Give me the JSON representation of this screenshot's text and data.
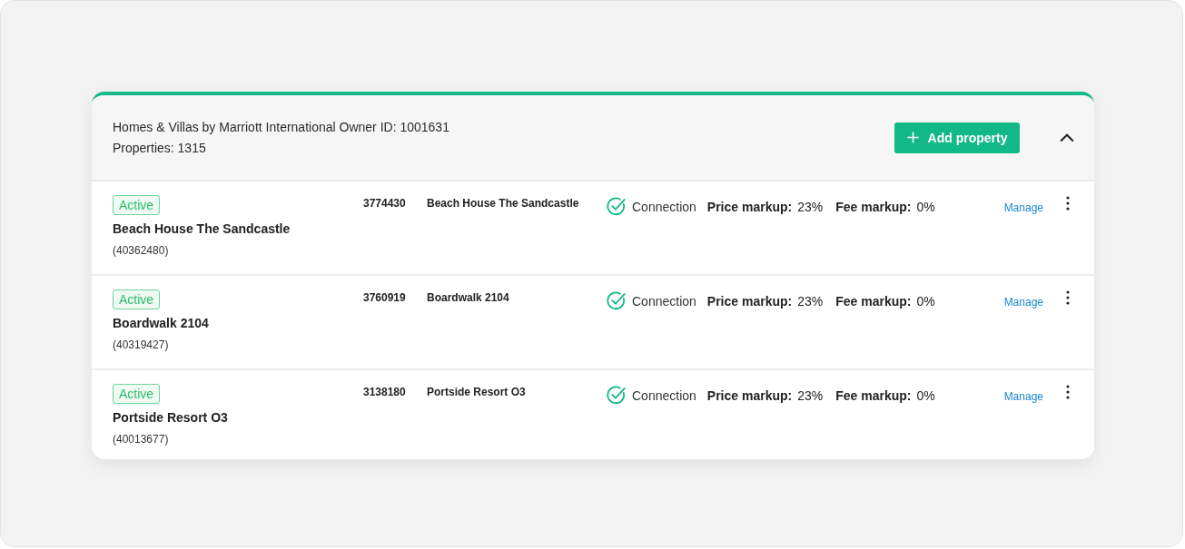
{
  "header": {
    "title": "Homes & Villas by Marriott International Owner ID: 1001631",
    "properties": "Properties: 1315",
    "add_button": "Add property",
    "expanded": true
  },
  "rows": [
    {
      "status": "Active",
      "name": "Beach House The Sandcastle",
      "id": "(40362480)",
      "code": "3774430",
      "listing": "Beach House The Sandcastle",
      "connection": "Connection",
      "connected": true,
      "price_label": "Price markup:",
      "price_value": "23%",
      "fee_label": "Fee markup:",
      "fee_value": "0%",
      "action": "Manage"
    },
    {
      "status": "Active",
      "name": "Boardwalk 2104",
      "id": "(40319427)",
      "code": "3760919",
      "listing": "Boardwalk 2104",
      "connection": "Connection",
      "connected": true,
      "price_label": "Price markup:",
      "price_value": "23%",
      "fee_label": "Fee markup:",
      "fee_value": "0%",
      "action": "Manage"
    },
    {
      "status": "Active",
      "name": "Portside Resort O3",
      "id": "(40013677)",
      "code": "3138180",
      "listing": "Portside Resort O3",
      "connection": "Connection",
      "connected": true,
      "price_label": "Price markup:",
      "price_value": "23%",
      "fee_label": "Fee markup:",
      "fee_value": "0%",
      "action": "Manage"
    }
  ]
}
